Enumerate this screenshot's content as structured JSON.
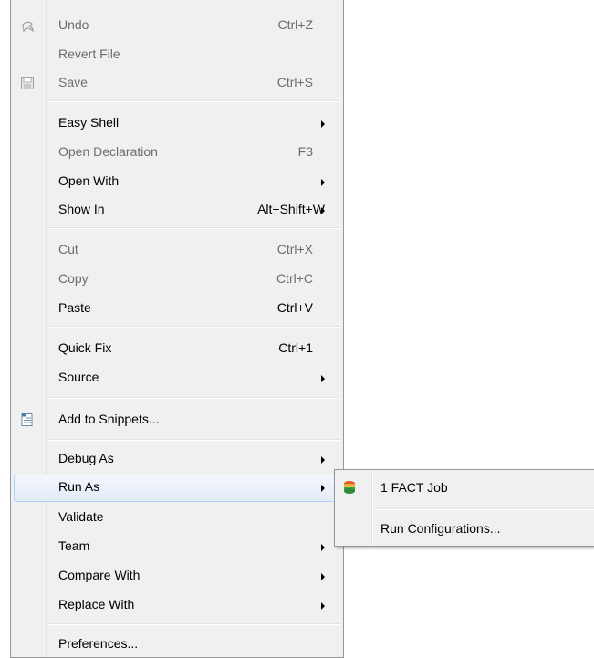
{
  "menu": {
    "undo": {
      "label": "Undo",
      "accel": "Ctrl+Z"
    },
    "revert": {
      "label": "Revert File"
    },
    "save": {
      "label": "Save",
      "accel": "Ctrl+S"
    },
    "easy_shell": {
      "label": "Easy Shell"
    },
    "open_declaration": {
      "label": "Open Declaration",
      "accel": "F3"
    },
    "open_with": {
      "label": "Open With"
    },
    "show_in": {
      "label": "Show In",
      "accel": "Alt+Shift+W"
    },
    "cut": {
      "label": "Cut",
      "accel": "Ctrl+X"
    },
    "copy": {
      "label": "Copy",
      "accel": "Ctrl+C"
    },
    "paste": {
      "label": "Paste",
      "accel": "Ctrl+V"
    },
    "quick_fix": {
      "label": "Quick Fix",
      "accel": "Ctrl+1"
    },
    "source": {
      "label": "Source"
    },
    "add_snippets": {
      "label": "Add to Snippets..."
    },
    "debug_as": {
      "label": "Debug As"
    },
    "run_as": {
      "label": "Run As"
    },
    "validate": {
      "label": "Validate"
    },
    "team": {
      "label": "Team"
    },
    "compare_with": {
      "label": "Compare With"
    },
    "replace_with": {
      "label": "Replace With"
    },
    "preferences": {
      "label": "Preferences..."
    }
  },
  "submenu": {
    "fact_job": {
      "label": "1 FACT Job"
    },
    "run_configurations": {
      "label": "Run Configurations..."
    }
  },
  "icons": {
    "undo": "undo-arrow-icon",
    "save": "floppy-disk-icon",
    "snippets": "snippets-icon",
    "fact_job": "fact-job-icon"
  }
}
